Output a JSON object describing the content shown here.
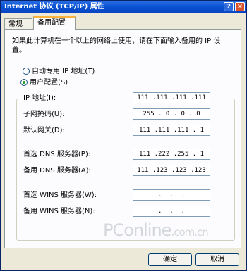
{
  "window": {
    "title": "Internet 协议 (TCP/IP) 属性"
  },
  "titlebar_buttons": {
    "help": "?",
    "close": "×"
  },
  "tabs": [
    {
      "label": "常规",
      "active": false
    },
    {
      "label": "备用配置",
      "active": true
    }
  ],
  "description": "如果此计算机在一个以上的网络上使用，请在下面输入备用的 IP 设置。",
  "options": {
    "auto_label": "自动专用 IP 地址(T)",
    "user_label": "用户配置(S)",
    "selected": "user"
  },
  "fields": {
    "ip": {
      "label": "IP 地址(I):",
      "value": "111 .111 .111 .111"
    },
    "subnet": {
      "label": "子网掩码(U):",
      "value": "255 . 0 . 0 . 0"
    },
    "gateway": {
      "label": "默认网关(D):",
      "value": "111 .111 .111 . 1"
    },
    "dns_pref": {
      "label": "首选 DNS 服务器(P):",
      "value": "111 .222 .255 . 1"
    },
    "dns_alt": {
      "label": "备用 DNS 服务器(A):",
      "value": "111 .123 .123 .123"
    },
    "wins_pref": {
      "label": "首选 WINS 服务器(W):",
      "value": " .  .  . "
    },
    "wins_alt": {
      "label": "备用 WINS 服务器(N):",
      "value": " .  .  . "
    }
  },
  "watermark": {
    "main": "PConline",
    "suffix": ".com.cn"
  },
  "buttons": {
    "ok": "确定",
    "cancel": "取消"
  },
  "colors": {
    "titlebar": "#0a53d4",
    "close": "#d9522c",
    "tab_highlight": "#f9b53b",
    "window_bg": "#ece9d8"
  }
}
